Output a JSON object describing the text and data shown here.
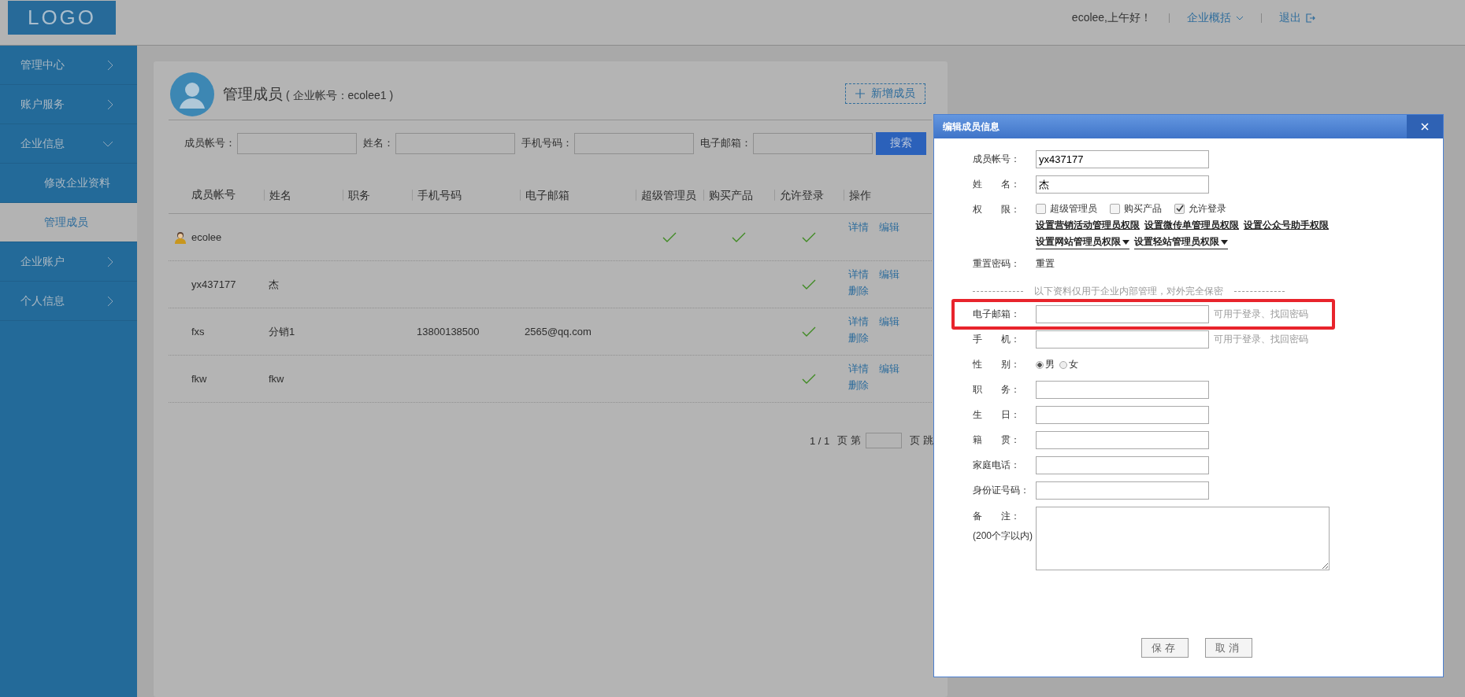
{
  "header": {
    "logo": "LOGO",
    "greeting": "ecolee,上午好！",
    "menu": "企业概括",
    "logout": "退出"
  },
  "sidebar": {
    "items": [
      {
        "label": "管理中心",
        "expanded": false
      },
      {
        "label": "账户服务",
        "expanded": false
      },
      {
        "label": "企业信息",
        "expanded": true,
        "children": [
          {
            "label": "修改企业资料",
            "selected": false
          },
          {
            "label": "管理成员",
            "selected": true
          }
        ]
      },
      {
        "label": "企业账户",
        "expanded": false
      },
      {
        "label": "个人信息",
        "expanded": false
      }
    ]
  },
  "page": {
    "title": "管理成员",
    "subtitle": "( 企业帐号：ecolee1 )",
    "add_button": "新增成员"
  },
  "search": {
    "fields": [
      {
        "label": "成员帐号："
      },
      {
        "label": "姓名："
      },
      {
        "label": "手机号码："
      },
      {
        "label": "电子邮箱："
      }
    ],
    "button": "搜索"
  },
  "table": {
    "columns": [
      "成员帐号",
      "姓名",
      "职务",
      "手机号码",
      "电子邮箱",
      "超级管理员",
      "购买产品",
      "允许登录",
      "操作"
    ],
    "rows": [
      {
        "account": "ecolee",
        "owner": true,
        "super_admin": true,
        "buy": true,
        "allow_login": true,
        "actions": [
          "详情",
          "编辑"
        ]
      },
      {
        "account": "yx437177",
        "owner": false,
        "name": "杰",
        "super_admin": false,
        "buy": false,
        "allow_login": true,
        "actions": [
          "详情",
          "编辑",
          "删除"
        ]
      },
      {
        "account": "fxs",
        "owner": false,
        "name": "分销1",
        "phone": "13800138500",
        "email": "2565@qq.com",
        "super_admin": false,
        "buy": false,
        "allow_login": true,
        "actions": [
          "详情",
          "编辑",
          "删除"
        ]
      },
      {
        "account": "fkw",
        "owner": false,
        "name": "fkw",
        "super_admin": false,
        "buy": false,
        "allow_login": true,
        "actions": [
          "详情",
          "编辑",
          "删除"
        ]
      }
    ]
  },
  "pagination": {
    "pages": "1 / 1",
    "before": "页 第",
    "after": "页 跳"
  },
  "dialog": {
    "title": "编辑成员信息",
    "account": {
      "label": "成员帐号：",
      "value": "yx437177"
    },
    "name": {
      "label": "姓　　名：",
      "value": "杰"
    },
    "permissions": {
      "label": "权　　限：",
      "options": [
        {
          "label": "超级管理员",
          "checked": false
        },
        {
          "label": "购买产品",
          "checked": false
        },
        {
          "label": "允许登录",
          "checked": true
        }
      ],
      "links": [
        "设置营销活动管理员权限",
        "设置微传单管理员权限",
        "设置公众号助手权限"
      ],
      "dropdowns": [
        "设置网站管理员权限",
        "设置轻站管理员权限"
      ]
    },
    "reset": {
      "label": "重置密码：",
      "link": "重置"
    },
    "note": "以下资料仅用于企业内部管理，对外完全保密",
    "fields": [
      {
        "kind": "text",
        "label": "电子邮箱：",
        "hint": "可用于登录、找回密码",
        "highlighted": true
      },
      {
        "kind": "text",
        "label": "手　　机：",
        "hint": "可用于登录、找回密码",
        "highlighted": false
      },
      {
        "kind": "radio",
        "label": "性　　别：",
        "options": [
          {
            "label": "男",
            "selected": true
          },
          {
            "label": "女",
            "selected": false
          }
        ]
      },
      {
        "kind": "text",
        "label": "职　　务：",
        "highlighted": false
      },
      {
        "kind": "text",
        "label": "生　　日：",
        "highlighted": false
      },
      {
        "kind": "text",
        "label": "籍　　贯：",
        "highlighted": false
      },
      {
        "kind": "text",
        "label": "家庭电话：",
        "highlighted": false
      },
      {
        "kind": "text",
        "label": "身份证号码：",
        "highlighted": false
      },
      {
        "kind": "textarea",
        "label": "备　　注：",
        "sublabel": "(200个字以内)"
      }
    ],
    "buttons": [
      "保存",
      "取消"
    ]
  }
}
